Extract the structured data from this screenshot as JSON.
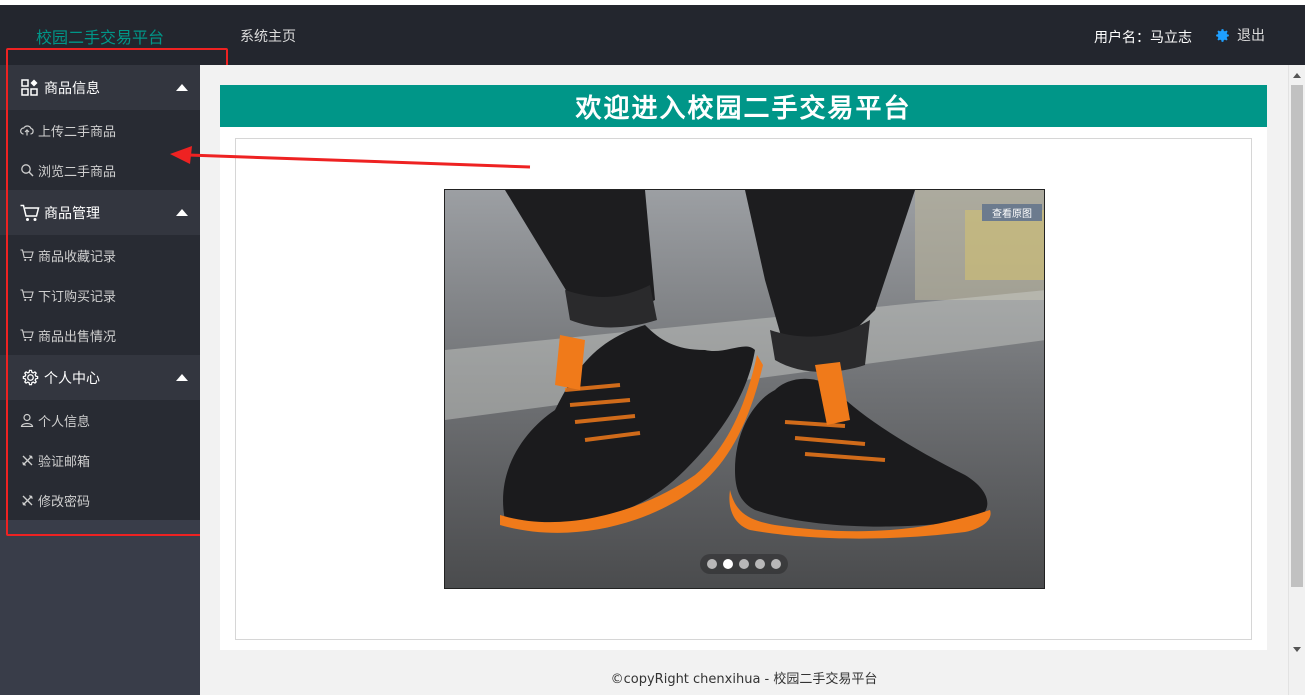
{
  "app": {
    "logo_text": "校园二手交易平台",
    "nav_home": "系统主页",
    "user_label": "用户名：马立志",
    "logout_label": "退出"
  },
  "sidebar": {
    "groups": [
      {
        "title": "商品信息",
        "icon": "grid-icon",
        "items": [
          {
            "label": "上传二手商品",
            "icon": "cloud-upload-icon"
          },
          {
            "label": "浏览二手商品",
            "icon": "search-icon"
          }
        ]
      },
      {
        "title": "商品管理",
        "icon": "cart-icon",
        "items": [
          {
            "label": "商品收藏记录",
            "icon": "cart-icon"
          },
          {
            "label": "下订购买记录",
            "icon": "cart-icon"
          },
          {
            "label": "商品出售情况",
            "icon": "cart-icon"
          }
        ]
      },
      {
        "title": "个人中心",
        "icon": "gear-icon",
        "items": [
          {
            "label": "个人信息",
            "icon": "user-icon"
          },
          {
            "label": "验证邮箱",
            "icon": "tools-icon"
          },
          {
            "label": "修改密码",
            "icon": "tools-icon"
          }
        ]
      }
    ]
  },
  "main": {
    "banner_title": "欢迎进入校园二手交易平台",
    "carousel": {
      "view_original_label": "查看原图",
      "slide_count": 5,
      "active_index": 1
    }
  },
  "footer": {
    "text": "©copyRight chenxihua - 校园二手交易平台"
  },
  "colors": {
    "header_bg": "#23262e",
    "sidebar_bg": "#393d49",
    "accent": "#009688",
    "annotation_red": "#ee2222"
  }
}
